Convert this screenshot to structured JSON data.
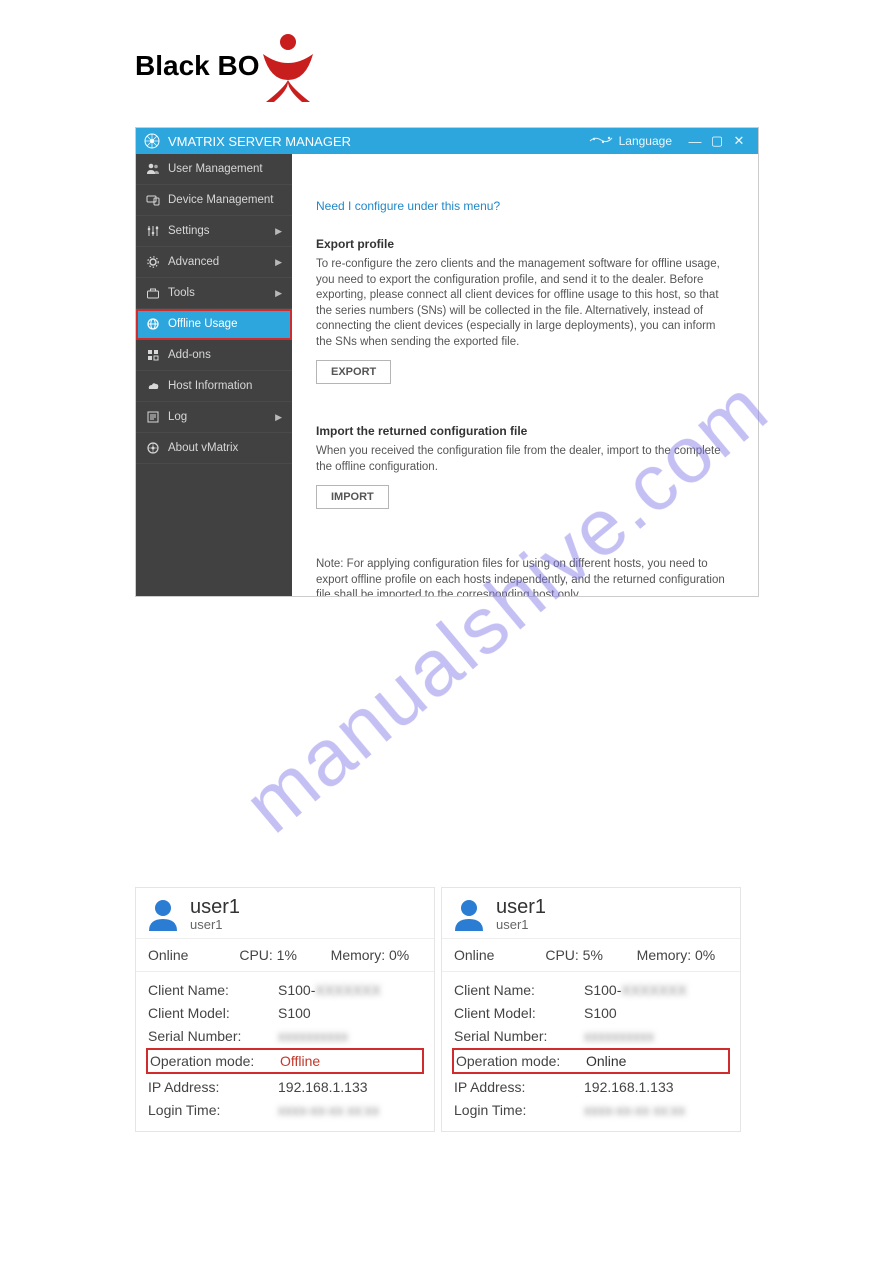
{
  "watermark": "manualshive.com",
  "logo": {
    "text": "Black BO"
  },
  "app": {
    "title": "VMATRIX SERVER MANAGER",
    "language_label": "Language",
    "sidebar": [
      {
        "label": "User Management",
        "arrow": false,
        "selected": false,
        "icon": "users"
      },
      {
        "label": "Device Management",
        "arrow": false,
        "selected": false,
        "icon": "device"
      },
      {
        "label": "Settings",
        "arrow": true,
        "selected": false,
        "icon": "sliders"
      },
      {
        "label": "Advanced",
        "arrow": true,
        "selected": false,
        "icon": "gear"
      },
      {
        "label": "Tools",
        "arrow": true,
        "selected": false,
        "icon": "toolbox"
      },
      {
        "label": "Offline Usage",
        "arrow": false,
        "selected": true,
        "icon": "offline"
      },
      {
        "label": "Add-ons",
        "arrow": false,
        "selected": false,
        "icon": "addons"
      },
      {
        "label": "Host Information",
        "arrow": false,
        "selected": false,
        "icon": "host"
      },
      {
        "label": "Log",
        "arrow": true,
        "selected": false,
        "icon": "log"
      },
      {
        "label": "About vMatrix",
        "arrow": false,
        "selected": false,
        "icon": "about"
      }
    ],
    "content": {
      "help_link": "Need I configure under this menu?",
      "export": {
        "title": "Export profile",
        "text": "To re-configure the zero clients and the management software for offline usage, you need to export the configuration profile, and send it to the dealer. Before exporting, please connect all client devices for offline usage to this host, so that the series numbers (SNs) will be collected in the file. Alternatively, instead of connecting the client devices (especially in large deployments), you can inform the SNs when sending the exported file.",
        "button": "EXPORT"
      },
      "import": {
        "title": "Import the returned configuration file",
        "text": "When you received the configuration file from the dealer, import to the complete the offline configuration.",
        "button": "IMPORT"
      },
      "note": "Note: For applying configuration files for using on different hosts, you need to export offline profile on each hosts independently, and the returned configuration file shall be imported to the corresponding host only."
    }
  },
  "cards": [
    {
      "username": "user1",
      "subname": "user1",
      "status": "Online",
      "cpu_label": "CPU:",
      "cpu_value": "1%",
      "mem_label": "Memory:",
      "mem_value": "0%",
      "rows": {
        "client_name_label": "Client Name:",
        "client_name_value": "S100-",
        "client_model_label": "Client Model:",
        "client_model_value": "S100",
        "serial_label": "Serial Number:",
        "serial_value": "xxxxxxxxxx",
        "opmode_label": "Operation mode:",
        "opmode_value": "Offline",
        "ip_label": "IP Address:",
        "ip_value": "192.168.1.133",
        "login_label": "Login Time:",
        "login_value": "xxxx-xx-xx xx:xx"
      }
    },
    {
      "username": "user1",
      "subname": "user1",
      "status": "Online",
      "cpu_label": "CPU:",
      "cpu_value": "5%",
      "mem_label": "Memory:",
      "mem_value": "0%",
      "rows": {
        "client_name_label": "Client Name:",
        "client_name_value": "S100-",
        "client_model_label": "Client Model:",
        "client_model_value": "S100",
        "serial_label": "Serial Number:",
        "serial_value": "xxxxxxxxxx",
        "opmode_label": "Operation mode:",
        "opmode_value": "Online",
        "ip_label": "IP Address:",
        "ip_value": "192.168.1.133",
        "login_label": "Login Time:",
        "login_value": "xxxx-xx-xx xx:xx"
      }
    }
  ]
}
